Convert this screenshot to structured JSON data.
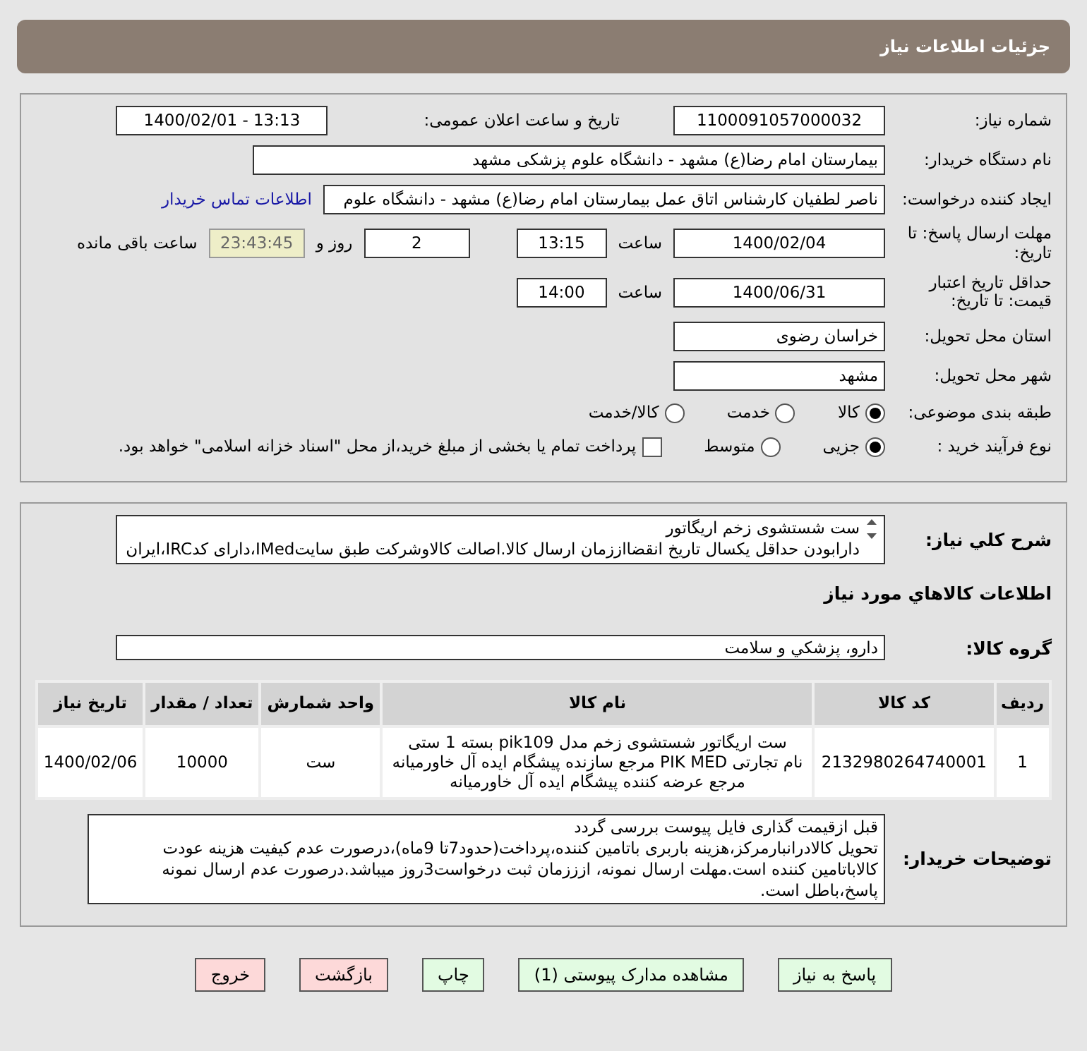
{
  "header": {
    "title": "جزئیات اطلاعات نیاز"
  },
  "details": {
    "need_number": {
      "label": "شماره نیاز:",
      "value": "1100091057000032"
    },
    "announce": {
      "label": "تاریخ و ساعت اعلان عمومی:",
      "value": "1400/02/01 - 13:13"
    },
    "buyer": {
      "label": "نام دستگاه خریدار:",
      "value": "بیمارستان امام رضا(ع) مشهد - دانشگاه علوم پزشکی مشهد"
    },
    "requester": {
      "label": "ایجاد کننده درخواست:",
      "value": "ناصر لطفیان کارشناس اتاق عمل بیمارستان امام رضا(ع) مشهد - دانشگاه علوم",
      "link": "اطلاعات تماس خریدار"
    },
    "deadline": {
      "label": "مهلت ارسال پاسخ: تا تاریخ:",
      "date": "1400/02/04",
      "time_label": "ساعت",
      "time": "13:15",
      "days": "2",
      "days_label": "روز و",
      "remaining": "23:43:45",
      "remaining_label": "ساعت باقی مانده"
    },
    "validity": {
      "label": "حداقل تاریخ اعتبار قیمت: تا تاریخ:",
      "date": "1400/06/31",
      "time_label": "ساعت",
      "time": "14:00"
    },
    "province": {
      "label": "استان محل تحویل:",
      "value": "خراسان رضوی"
    },
    "city": {
      "label": "شهر محل تحویل:",
      "value": "مشهد"
    },
    "category": {
      "label": "طبقه بندی موضوعی:",
      "options": [
        {
          "label": "کالا",
          "selected": true
        },
        {
          "label": "خدمت",
          "selected": false
        },
        {
          "label": "کالا/خدمت",
          "selected": false
        }
      ]
    },
    "process": {
      "label": "نوع فرآیند خرید :",
      "options": [
        {
          "label": "جزیی",
          "selected": true
        },
        {
          "label": "متوسط",
          "selected": false
        }
      ],
      "treasury": {
        "label": "پرداخت تمام یا بخشی از مبلغ خرید،از محل \"اسناد خزانه اسلامی\" خواهد بود.",
        "checked": false
      }
    }
  },
  "goods": {
    "description": {
      "label": "شرح کلي نياز:",
      "lines": [
        "ست شستشوی زخم اریگاتور",
        "دارابودن حداقل یکسال تاریخ انقضااززمان ارسال کالا.اصالت کالاوشرکت طبق سایتIMed،دارای کدIRC،ایران"
      ]
    },
    "heading": "اطلاعات کالاهاي مورد نياز",
    "group": {
      "label": "گروه کالا:",
      "value": "دارو، پزشکي و سلامت"
    },
    "table": {
      "columns": [
        "ردیف",
        "کد کالا",
        "نام کالا",
        "واحد شمارش",
        "تعداد / مقدار",
        "تاریخ نیاز"
      ],
      "rows": [
        {
          "cells": [
            "1",
            "2132980264740001",
            [
              "ست اریگاتور شستشوی زخم مدل pik109 بسته 1 ستی",
              "نام تجارتی PIK MED مرجع سازنده پیشگام ایده آل خاورمیانه",
              "مرجع عرضه کننده پیشگام ایده آل خاورمیانه"
            ],
            "ست",
            "10000",
            "1400/02/06"
          ]
        }
      ]
    },
    "notes": {
      "label": "توضیحات خریدار:",
      "lines": [
        "قبل ازقیمت گذاری فایل پیوست بررسی گردد",
        "تحویل کالادرانبارمرکز،هزینه باربری باتامین کننده،پرداخت(حدود7تا 9ماه)،درصورت عدم کیفیت هزینه عودت",
        "کالاباتامین کننده است.مهلت ارسال نمونه، ازززمان ثبت درخواست3روز میباشد.درصورت عدم ارسال نمونه",
        "پاسخ،باطل است."
      ]
    }
  },
  "buttons": [
    {
      "label": "پاسخ به نیاز",
      "kind": "action"
    },
    {
      "label": "مشاهده مدارک پیوستی (1)",
      "kind": "action"
    },
    {
      "label": "چاپ",
      "kind": "action"
    },
    {
      "label": "بازگشت",
      "kind": "exit"
    },
    {
      "label": "خروج",
      "kind": "exit"
    }
  ]
}
